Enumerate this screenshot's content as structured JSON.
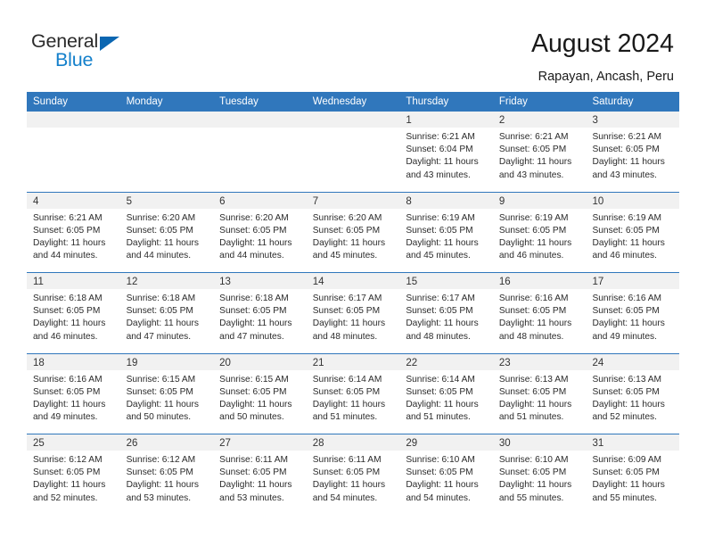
{
  "brand": {
    "name_part1": "General",
    "name_part2": "Blue",
    "accent_color": "#1480cb",
    "triangle_color": "#0b66b1"
  },
  "header": {
    "title": "August 2024",
    "subtitle": "Rapayan, Ancash, Peru"
  },
  "theme": {
    "header_bar_color": "#3077bc",
    "daynum_strip_color": "#f1f1f1"
  },
  "weekdays": [
    "Sunday",
    "Monday",
    "Tuesday",
    "Wednesday",
    "Thursday",
    "Friday",
    "Saturday"
  ],
  "weeks": [
    [
      {
        "day": "",
        "empty": true,
        "sunrise": "",
        "sunset": "",
        "daylight_line1": "",
        "daylight_line2": ""
      },
      {
        "day": "",
        "empty": true,
        "sunrise": "",
        "sunset": "",
        "daylight_line1": "",
        "daylight_line2": ""
      },
      {
        "day": "",
        "empty": true,
        "sunrise": "",
        "sunset": "",
        "daylight_line1": "",
        "daylight_line2": ""
      },
      {
        "day": "",
        "empty": true,
        "sunrise": "",
        "sunset": "",
        "daylight_line1": "",
        "daylight_line2": ""
      },
      {
        "day": "1",
        "empty": false,
        "sunrise": "Sunrise: 6:21 AM",
        "sunset": "Sunset: 6:04 PM",
        "daylight_line1": "Daylight: 11 hours",
        "daylight_line2": "and 43 minutes."
      },
      {
        "day": "2",
        "empty": false,
        "sunrise": "Sunrise: 6:21 AM",
        "sunset": "Sunset: 6:05 PM",
        "daylight_line1": "Daylight: 11 hours",
        "daylight_line2": "and 43 minutes."
      },
      {
        "day": "3",
        "empty": false,
        "sunrise": "Sunrise: 6:21 AM",
        "sunset": "Sunset: 6:05 PM",
        "daylight_line1": "Daylight: 11 hours",
        "daylight_line2": "and 43 minutes."
      }
    ],
    [
      {
        "day": "4",
        "empty": false,
        "sunrise": "Sunrise: 6:21 AM",
        "sunset": "Sunset: 6:05 PM",
        "daylight_line1": "Daylight: 11 hours",
        "daylight_line2": "and 44 minutes."
      },
      {
        "day": "5",
        "empty": false,
        "sunrise": "Sunrise: 6:20 AM",
        "sunset": "Sunset: 6:05 PM",
        "daylight_line1": "Daylight: 11 hours",
        "daylight_line2": "and 44 minutes."
      },
      {
        "day": "6",
        "empty": false,
        "sunrise": "Sunrise: 6:20 AM",
        "sunset": "Sunset: 6:05 PM",
        "daylight_line1": "Daylight: 11 hours",
        "daylight_line2": "and 44 minutes."
      },
      {
        "day": "7",
        "empty": false,
        "sunrise": "Sunrise: 6:20 AM",
        "sunset": "Sunset: 6:05 PM",
        "daylight_line1": "Daylight: 11 hours",
        "daylight_line2": "and 45 minutes."
      },
      {
        "day": "8",
        "empty": false,
        "sunrise": "Sunrise: 6:19 AM",
        "sunset": "Sunset: 6:05 PM",
        "daylight_line1": "Daylight: 11 hours",
        "daylight_line2": "and 45 minutes."
      },
      {
        "day": "9",
        "empty": false,
        "sunrise": "Sunrise: 6:19 AM",
        "sunset": "Sunset: 6:05 PM",
        "daylight_line1": "Daylight: 11 hours",
        "daylight_line2": "and 46 minutes."
      },
      {
        "day": "10",
        "empty": false,
        "sunrise": "Sunrise: 6:19 AM",
        "sunset": "Sunset: 6:05 PM",
        "daylight_line1": "Daylight: 11 hours",
        "daylight_line2": "and 46 minutes."
      }
    ],
    [
      {
        "day": "11",
        "empty": false,
        "sunrise": "Sunrise: 6:18 AM",
        "sunset": "Sunset: 6:05 PM",
        "daylight_line1": "Daylight: 11 hours",
        "daylight_line2": "and 46 minutes."
      },
      {
        "day": "12",
        "empty": false,
        "sunrise": "Sunrise: 6:18 AM",
        "sunset": "Sunset: 6:05 PM",
        "daylight_line1": "Daylight: 11 hours",
        "daylight_line2": "and 47 minutes."
      },
      {
        "day": "13",
        "empty": false,
        "sunrise": "Sunrise: 6:18 AM",
        "sunset": "Sunset: 6:05 PM",
        "daylight_line1": "Daylight: 11 hours",
        "daylight_line2": "and 47 minutes."
      },
      {
        "day": "14",
        "empty": false,
        "sunrise": "Sunrise: 6:17 AM",
        "sunset": "Sunset: 6:05 PM",
        "daylight_line1": "Daylight: 11 hours",
        "daylight_line2": "and 48 minutes."
      },
      {
        "day": "15",
        "empty": false,
        "sunrise": "Sunrise: 6:17 AM",
        "sunset": "Sunset: 6:05 PM",
        "daylight_line1": "Daylight: 11 hours",
        "daylight_line2": "and 48 minutes."
      },
      {
        "day": "16",
        "empty": false,
        "sunrise": "Sunrise: 6:16 AM",
        "sunset": "Sunset: 6:05 PM",
        "daylight_line1": "Daylight: 11 hours",
        "daylight_line2": "and 48 minutes."
      },
      {
        "day": "17",
        "empty": false,
        "sunrise": "Sunrise: 6:16 AM",
        "sunset": "Sunset: 6:05 PM",
        "daylight_line1": "Daylight: 11 hours",
        "daylight_line2": "and 49 minutes."
      }
    ],
    [
      {
        "day": "18",
        "empty": false,
        "sunrise": "Sunrise: 6:16 AM",
        "sunset": "Sunset: 6:05 PM",
        "daylight_line1": "Daylight: 11 hours",
        "daylight_line2": "and 49 minutes."
      },
      {
        "day": "19",
        "empty": false,
        "sunrise": "Sunrise: 6:15 AM",
        "sunset": "Sunset: 6:05 PM",
        "daylight_line1": "Daylight: 11 hours",
        "daylight_line2": "and 50 minutes."
      },
      {
        "day": "20",
        "empty": false,
        "sunrise": "Sunrise: 6:15 AM",
        "sunset": "Sunset: 6:05 PM",
        "daylight_line1": "Daylight: 11 hours",
        "daylight_line2": "and 50 minutes."
      },
      {
        "day": "21",
        "empty": false,
        "sunrise": "Sunrise: 6:14 AM",
        "sunset": "Sunset: 6:05 PM",
        "daylight_line1": "Daylight: 11 hours",
        "daylight_line2": "and 51 minutes."
      },
      {
        "day": "22",
        "empty": false,
        "sunrise": "Sunrise: 6:14 AM",
        "sunset": "Sunset: 6:05 PM",
        "daylight_line1": "Daylight: 11 hours",
        "daylight_line2": "and 51 minutes."
      },
      {
        "day": "23",
        "empty": false,
        "sunrise": "Sunrise: 6:13 AM",
        "sunset": "Sunset: 6:05 PM",
        "daylight_line1": "Daylight: 11 hours",
        "daylight_line2": "and 51 minutes."
      },
      {
        "day": "24",
        "empty": false,
        "sunrise": "Sunrise: 6:13 AM",
        "sunset": "Sunset: 6:05 PM",
        "daylight_line1": "Daylight: 11 hours",
        "daylight_line2": "and 52 minutes."
      }
    ],
    [
      {
        "day": "25",
        "empty": false,
        "sunrise": "Sunrise: 6:12 AM",
        "sunset": "Sunset: 6:05 PM",
        "daylight_line1": "Daylight: 11 hours",
        "daylight_line2": "and 52 minutes."
      },
      {
        "day": "26",
        "empty": false,
        "sunrise": "Sunrise: 6:12 AM",
        "sunset": "Sunset: 6:05 PM",
        "daylight_line1": "Daylight: 11 hours",
        "daylight_line2": "and 53 minutes."
      },
      {
        "day": "27",
        "empty": false,
        "sunrise": "Sunrise: 6:11 AM",
        "sunset": "Sunset: 6:05 PM",
        "daylight_line1": "Daylight: 11 hours",
        "daylight_line2": "and 53 minutes."
      },
      {
        "day": "28",
        "empty": false,
        "sunrise": "Sunrise: 6:11 AM",
        "sunset": "Sunset: 6:05 PM",
        "daylight_line1": "Daylight: 11 hours",
        "daylight_line2": "and 54 minutes."
      },
      {
        "day": "29",
        "empty": false,
        "sunrise": "Sunrise: 6:10 AM",
        "sunset": "Sunset: 6:05 PM",
        "daylight_line1": "Daylight: 11 hours",
        "daylight_line2": "and 54 minutes."
      },
      {
        "day": "30",
        "empty": false,
        "sunrise": "Sunrise: 6:10 AM",
        "sunset": "Sunset: 6:05 PM",
        "daylight_line1": "Daylight: 11 hours",
        "daylight_line2": "and 55 minutes."
      },
      {
        "day": "31",
        "empty": false,
        "sunrise": "Sunrise: 6:09 AM",
        "sunset": "Sunset: 6:05 PM",
        "daylight_line1": "Daylight: 11 hours",
        "daylight_line2": "and 55 minutes."
      }
    ]
  ]
}
